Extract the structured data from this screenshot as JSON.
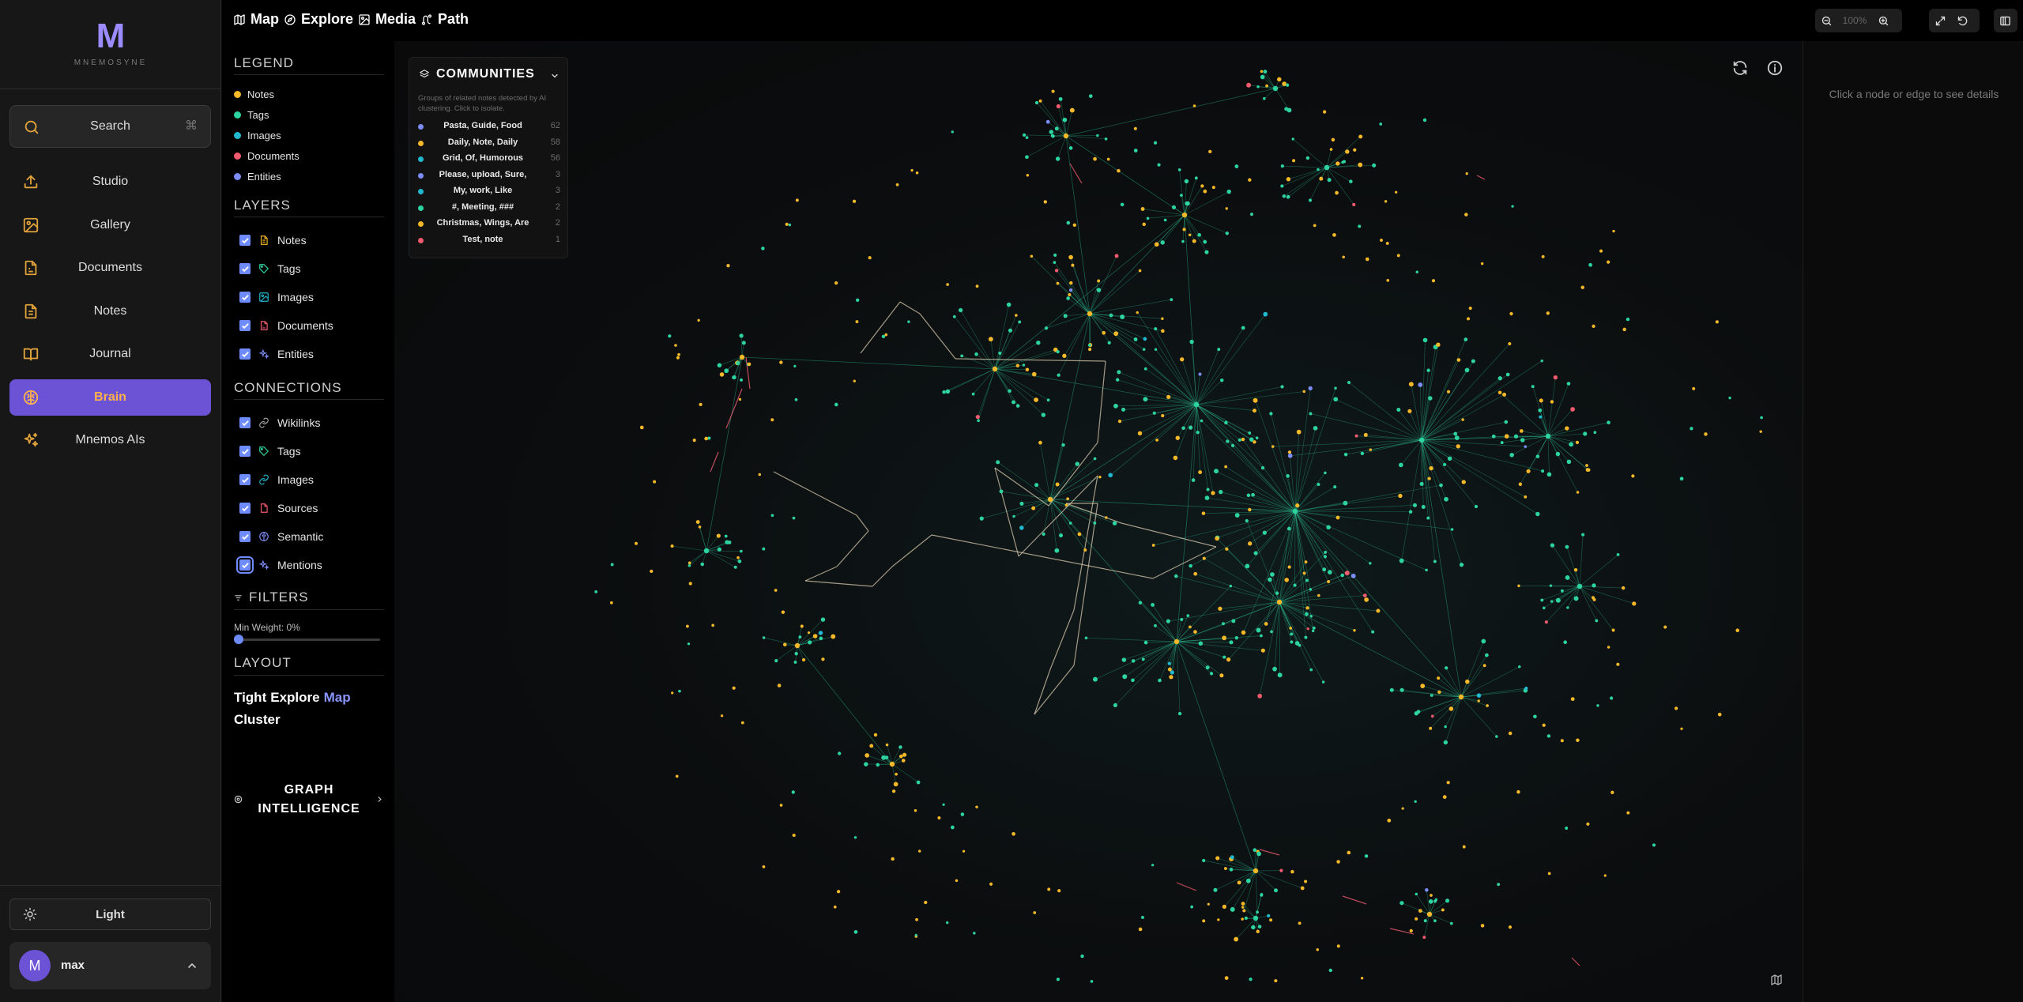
{
  "app": {
    "logo_letter": "M",
    "name": "MNEMOSYNE"
  },
  "search": {
    "label": "Search",
    "shortcut": "⌘"
  },
  "nav": [
    {
      "label": "Studio",
      "icon": "upload-icon"
    },
    {
      "label": "Gallery",
      "icon": "image-icon"
    },
    {
      "label": "Documents",
      "icon": "document-icon"
    },
    {
      "label": "Notes",
      "icon": "note-icon"
    },
    {
      "label": "Journal",
      "icon": "book-icon"
    },
    {
      "label": "Brain",
      "icon": "brain-icon",
      "active": true
    },
    {
      "label": "Mnemos AIs",
      "icon": "sparkles-icon"
    }
  ],
  "theme_toggle": {
    "label": "Light"
  },
  "user": {
    "initial": "M",
    "name": "max"
  },
  "topbar": {
    "tabs": [
      "Map",
      "Explore",
      "Media",
      "Path"
    ],
    "zoom": "100%"
  },
  "legend": {
    "title": "LEGEND",
    "items": [
      {
        "label": "Notes",
        "color": "#f4b829"
      },
      {
        "label": "Tags",
        "color": "#2dd4a0"
      },
      {
        "label": "Images",
        "color": "#22b8cf"
      },
      {
        "label": "Documents",
        "color": "#ef5a6f"
      },
      {
        "label": "Entities",
        "color": "#7c8cf8"
      }
    ]
  },
  "layers": {
    "title": "LAYERS",
    "items": [
      "Notes",
      "Tags",
      "Images",
      "Documents",
      "Entities"
    ]
  },
  "connections": {
    "title": "CONNECTIONS",
    "items": [
      "Wikilinks",
      "Tags",
      "Images",
      "Sources",
      "Semantic",
      "Mentions"
    ]
  },
  "filters": {
    "title": "FILTERS",
    "min_weight_label": "Min Weight: 0%",
    "min_weight": 0
  },
  "layout": {
    "title": "LAYOUT",
    "options": [
      "Tight",
      "Explore",
      "Map",
      "Cluster"
    ],
    "selected": "Map"
  },
  "graph_intelligence": {
    "line1": "GRAPH",
    "line2": "INTELLIGENCE"
  },
  "communities": {
    "title": "COMMUNITIES",
    "description": "Groups of related notes detected by AI clustering. Click to isolate.",
    "items": [
      {
        "name": "Pasta, Guide, Food",
        "count": "62",
        "color": "#7c8cf8"
      },
      {
        "name": "Daily, Note, Daily",
        "count": "58",
        "color": "#f4b829"
      },
      {
        "name": "Grid, Of, Humorous",
        "count": "56",
        "color": "#22b8cf"
      },
      {
        "name": "Please, upload, Sure,",
        "count": "3",
        "color": "#7c8cf8"
      },
      {
        "name": "My, work, Like",
        "count": "3",
        "color": "#22b8cf"
      },
      {
        "name": "#, Meeting, ###",
        "count": "2",
        "color": "#2dd4a0"
      },
      {
        "name": "Christmas, Wings, Are",
        "count": "2",
        "color": "#f4b829"
      },
      {
        "name": "Test, note",
        "count": "1",
        "color": "#ef5a6f"
      }
    ]
  },
  "details": {
    "hint": "Click a node or edge to see details"
  }
}
